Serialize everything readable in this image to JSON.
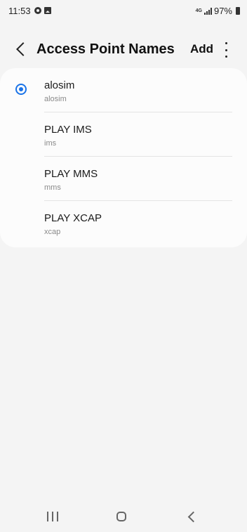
{
  "status_bar": {
    "time": "11:53",
    "network": "4G",
    "battery": "97%",
    "icons": [
      "settings-notification-icon",
      "image-notification-icon",
      "signal-icon",
      "battery-icon"
    ]
  },
  "app_bar": {
    "title": "Access Point Names",
    "add_label": "Add",
    "icons": [
      "back-icon",
      "more-options-icon"
    ]
  },
  "apns": [
    {
      "name": "alosim",
      "sub": "alosim",
      "selected": true
    },
    {
      "name": "PLAY IMS",
      "sub": "ims",
      "selected": false
    },
    {
      "name": "PLAY MMS",
      "sub": "mms",
      "selected": false
    },
    {
      "name": "PLAY XCAP",
      "sub": "xcap",
      "selected": false
    }
  ],
  "nav_bar": {
    "icons": [
      "recent-apps-icon",
      "home-icon",
      "back-icon"
    ]
  },
  "colors": {
    "accent": "#1a73e8",
    "background": "#f4f4f4",
    "card": "#fcfcfc"
  }
}
